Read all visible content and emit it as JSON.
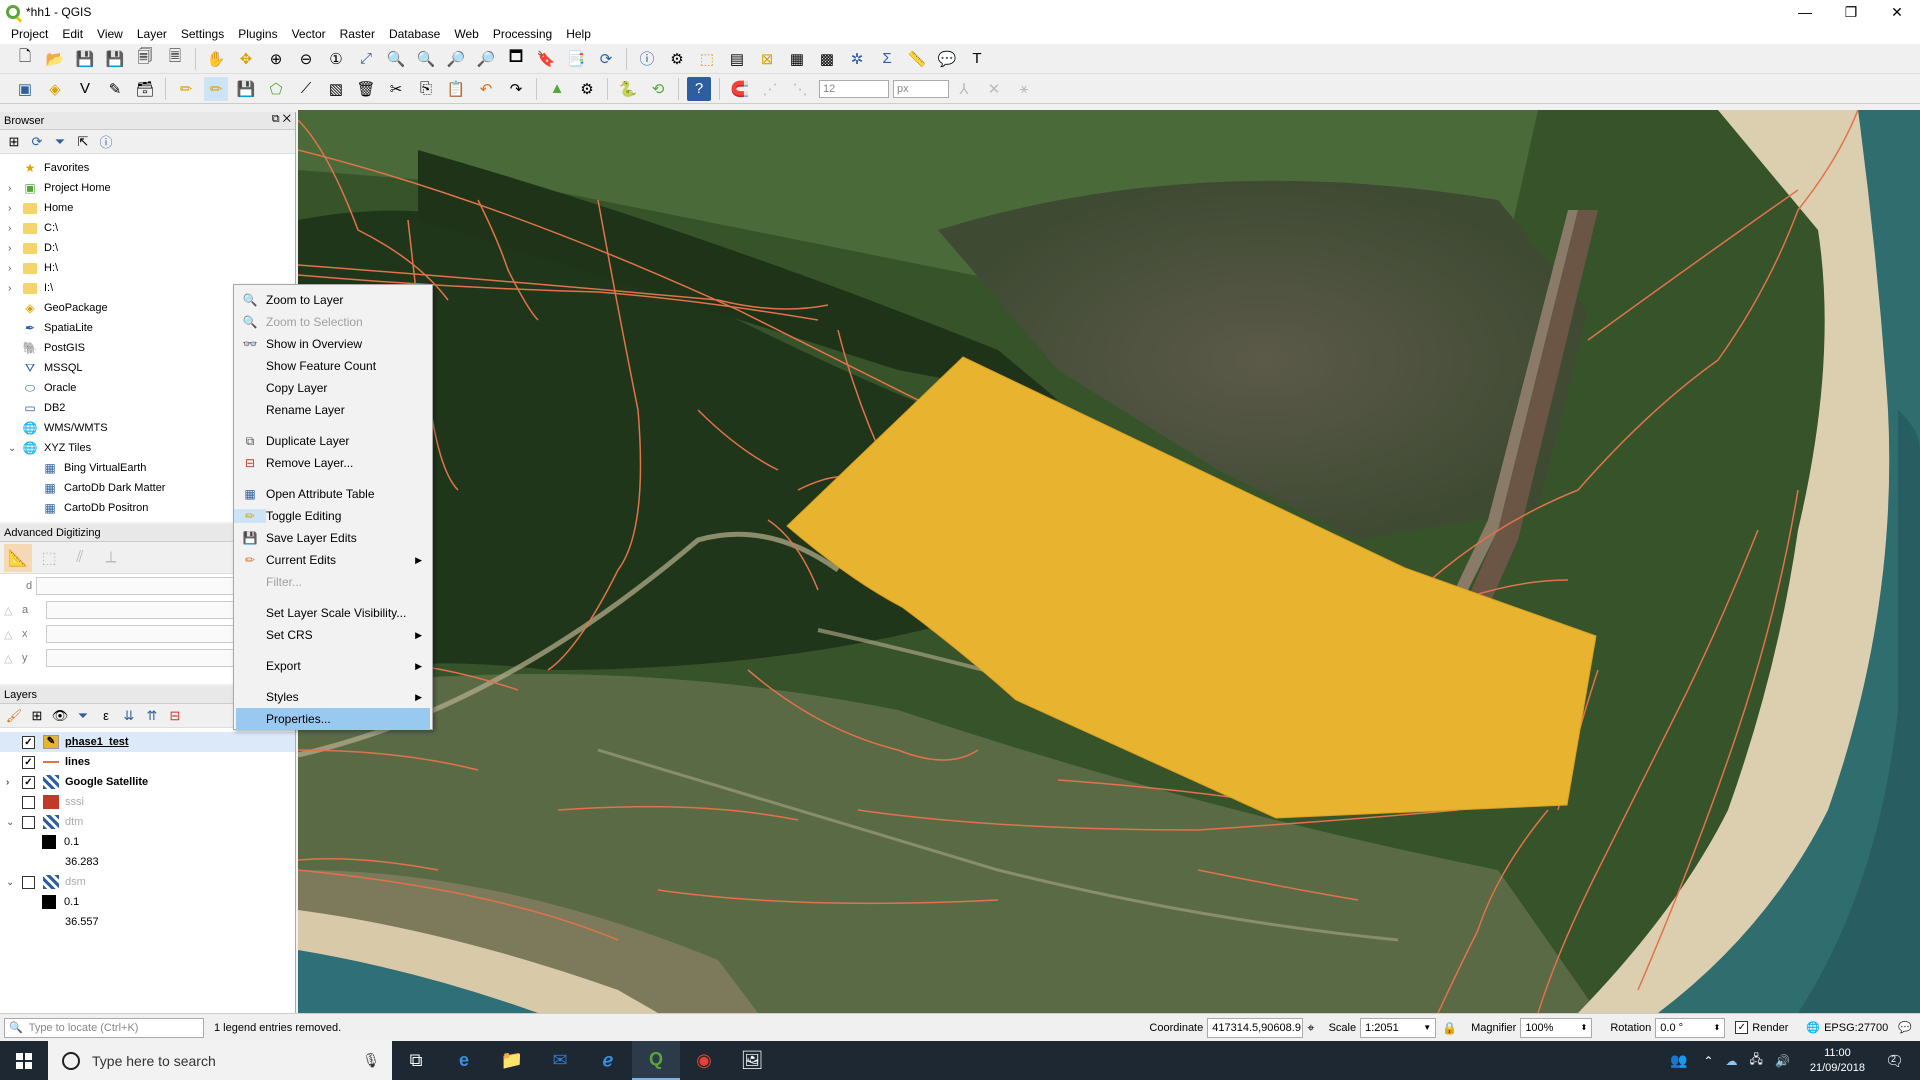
{
  "window": {
    "title": "*hh1 - QGIS",
    "minimize": "—",
    "maximize": "❐",
    "close": "✕"
  },
  "menubar": [
    "Project",
    "Edit",
    "View",
    "Layer",
    "Settings",
    "Plugins",
    "Vector",
    "Raster",
    "Database",
    "Web",
    "Processing",
    "Help"
  ],
  "toolbar2": {
    "snap_tolerance": "12",
    "snap_unit": "px"
  },
  "browser": {
    "title": "Browser",
    "items": [
      {
        "label": "Favorites",
        "icon": "star-icon"
      },
      {
        "label": "Project Home",
        "icon": "project-home-icon"
      },
      {
        "label": "Home",
        "icon": "folder-icon"
      },
      {
        "label": "C:\\",
        "icon": "folder-icon"
      },
      {
        "label": "D:\\",
        "icon": "folder-icon"
      },
      {
        "label": "H:\\",
        "icon": "folder-icon"
      },
      {
        "label": "I:\\",
        "icon": "folder-icon"
      },
      {
        "label": "GeoPackage",
        "icon": "geopackage-icon"
      },
      {
        "label": "SpatiaLite",
        "icon": "spatialite-icon"
      },
      {
        "label": "PostGIS",
        "icon": "postgis-icon"
      },
      {
        "label": "MSSQL",
        "icon": "mssql-icon"
      },
      {
        "label": "Oracle",
        "icon": "oracle-icon"
      },
      {
        "label": "DB2",
        "icon": "db2-icon"
      },
      {
        "label": "WMS/WMTS",
        "icon": "wms-icon"
      },
      {
        "label": "XYZ Tiles",
        "icon": "xyz-icon"
      }
    ],
    "xyz_children": [
      "Bing VirtualEarth",
      "CartoDb Dark Matter",
      "CartoDb Positron"
    ]
  },
  "advanced_digitizing": {
    "title": "Advanced Digitizing",
    "fields": [
      "d",
      "a",
      "x",
      "y"
    ]
  },
  "layers": {
    "title": "Layers",
    "items": [
      {
        "label": "phase1_test",
        "checked": true
      },
      {
        "label": "lines",
        "checked": true
      },
      {
        "label": "Google Satellite",
        "checked": true
      },
      {
        "label": "sssi",
        "checked": false
      },
      {
        "label": "dtm",
        "checked": false
      },
      {
        "label": "dsm",
        "checked": false
      }
    ],
    "dtm_legend": {
      "min": "0.1",
      "max": "36.283"
    },
    "dsm_legend": {
      "min": "0.1",
      "max": "36.557"
    }
  },
  "context_menu": {
    "items": [
      {
        "label": "Zoom to Layer",
        "icon": "zoom-layer-icon",
        "enabled": true
      },
      {
        "label": "Zoom to Selection",
        "icon": "zoom-selection-icon",
        "enabled": false
      },
      {
        "label": "Show in Overview",
        "icon": "overview-icon",
        "enabled": true
      },
      {
        "label": "Show Feature Count",
        "icon": "",
        "enabled": true
      },
      {
        "label": "Copy Layer",
        "icon": "",
        "enabled": true
      },
      {
        "label": "Rename Layer",
        "icon": "",
        "enabled": true
      },
      {
        "label": "Duplicate Layer",
        "icon": "duplicate-icon",
        "enabled": true
      },
      {
        "label": "Remove Layer...",
        "icon": "remove-icon",
        "enabled": true
      },
      {
        "label": "Open Attribute Table",
        "icon": "table-icon",
        "enabled": true
      },
      {
        "label": "Toggle Editing",
        "icon": "pencil-icon",
        "enabled": true
      },
      {
        "label": "Save Layer Edits",
        "icon": "save-edits-icon",
        "enabled": true
      },
      {
        "label": "Current Edits",
        "icon": "current-edits-icon",
        "enabled": true
      },
      {
        "label": "Filter...",
        "icon": "",
        "enabled": false
      },
      {
        "label": "Set Layer Scale Visibility...",
        "icon": "",
        "enabled": true
      },
      {
        "label": "Set CRS",
        "icon": "",
        "enabled": true
      },
      {
        "label": "Export",
        "icon": "",
        "enabled": true
      },
      {
        "label": "Styles",
        "icon": "",
        "enabled": true
      },
      {
        "label": "Properties...",
        "icon": "",
        "enabled": true
      }
    ]
  },
  "statusbar": {
    "locate_placeholder": "Type to locate (Ctrl+K)",
    "message": "1 legend entries removed.",
    "coordinate_label": "Coordinate",
    "coordinate_value": "417314.5,90608.9",
    "scale_label": "Scale",
    "scale_value": "1:2051",
    "magnifier_label": "Magnifier",
    "magnifier_value": "100%",
    "rotation_label": "Rotation",
    "rotation_value": "0.0 °",
    "render_label": "Render",
    "crs": "EPSG:27700"
  },
  "taskbar": {
    "search_placeholder": "Type here to search",
    "time": "11:00",
    "date": "21/09/2018",
    "notification_count": "2"
  },
  "colors": {
    "polygon_fill": "#e8b430",
    "vector_lines": "#e0734a",
    "menu_highlight": "#99c9ef"
  }
}
